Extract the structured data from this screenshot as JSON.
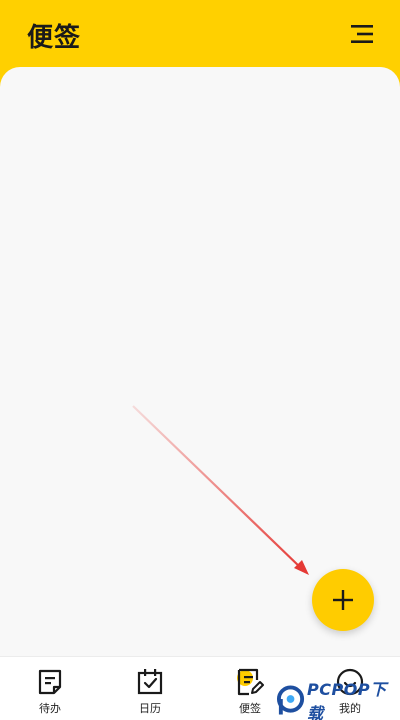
{
  "header": {
    "title": "便签",
    "menu_icon": "menu-lines-icon"
  },
  "fab": {
    "icon": "plus-icon"
  },
  "bottom_nav": {
    "items": [
      {
        "label": "待办",
        "icon": "todo-note-icon"
      },
      {
        "label": "日历",
        "icon": "calendar-check-icon"
      },
      {
        "label": "便签",
        "icon": "sticky-note-edit-icon",
        "active": true
      },
      {
        "label": "我的",
        "icon": "smiley-icon"
      }
    ]
  },
  "watermark": {
    "text": "PCPOP下载"
  },
  "colors": {
    "brand_yellow": "#ffd000",
    "fab_yellow": "#ffcc00",
    "content_bg": "#f8f8f8",
    "arrow_red": "#e53935",
    "watermark_blue": "#1e4fa0"
  }
}
